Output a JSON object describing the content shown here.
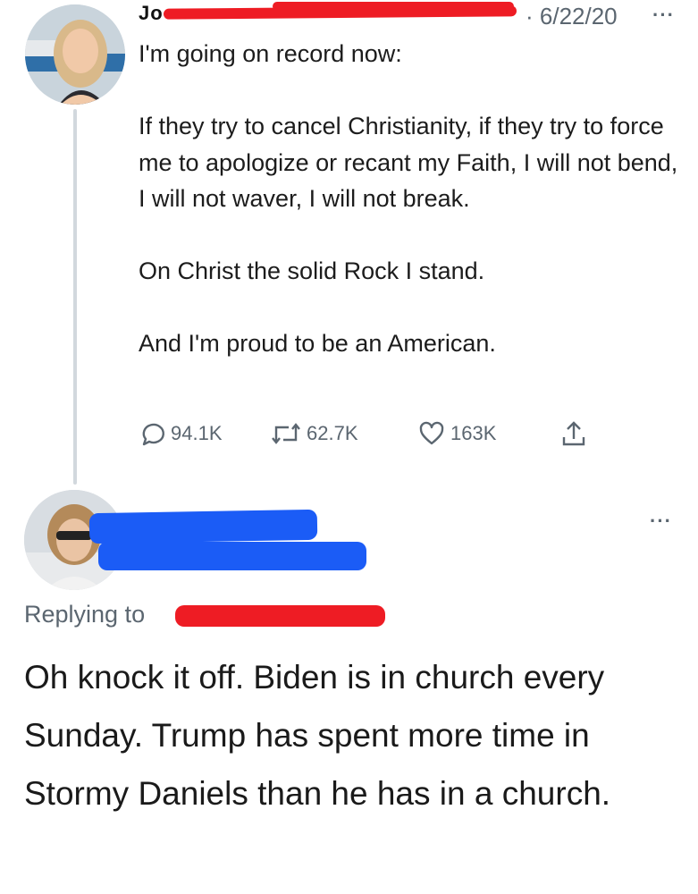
{
  "tweet": {
    "author_name_visible": "Jo",
    "date": "· 6/22/20",
    "more_label": "···",
    "lines": [
      "I'm going on record now:",
      "If they try to cancel Christianity, if they try to force me to apologize or recant my Faith, I will not bend, I will not waver, I will not break.",
      "On Christ the solid Rock I stand.",
      "And I'm proud to be an American."
    ],
    "stats": {
      "replies": "94.1K",
      "retweets": "62.7K",
      "likes": "163K"
    }
  },
  "reply": {
    "more_label": "···",
    "replying_to_label": "Replying to",
    "text": "Oh knock it off.  Biden is in church every Sunday.  Trump has spent more time in Stormy Daniels than he has in a church."
  },
  "colors": {
    "text": "#1c1c1c",
    "secondary": "#5b6670",
    "thread_line": "#d2d8dd",
    "redaction_red": "#ee1c24",
    "redaction_blue": "#1b5cf6"
  },
  "icons": [
    "reply-icon",
    "retweet-icon",
    "like-icon",
    "share-icon"
  ]
}
